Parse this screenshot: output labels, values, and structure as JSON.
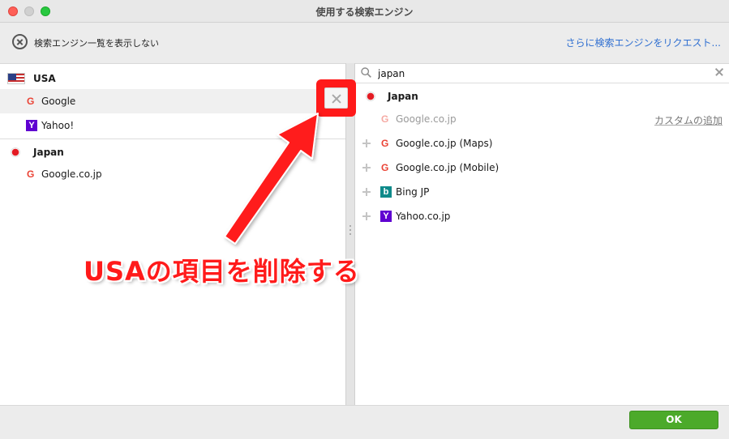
{
  "window": {
    "title": "使用する検索エンジン"
  },
  "toolbar": {
    "hide_list_label": "検索エンジン一覧を表示しない",
    "request_link": "さらに検索エンジンをリクエスト..."
  },
  "left": {
    "groups": [
      {
        "region": "USA",
        "engines": [
          "Google",
          "Yahoo!"
        ]
      },
      {
        "region": "Japan",
        "engines": [
          "Google.co.jp"
        ]
      }
    ]
  },
  "search": {
    "value": "japan"
  },
  "right": {
    "region": "Japan",
    "added": {
      "label": "Google.co.jp",
      "action": "カスタムの追加"
    },
    "engines": [
      "Google.co.jp (Maps)",
      "Google.co.jp (Mobile)",
      "Bing JP",
      "Yahoo.co.jp"
    ]
  },
  "footer": {
    "ok_label": "OK"
  },
  "annotation": {
    "text": "USAの項目を削除する",
    "color": "#ff1a1a"
  },
  "icons": {
    "google": "G",
    "yahoo": "Y",
    "bing": "b"
  }
}
